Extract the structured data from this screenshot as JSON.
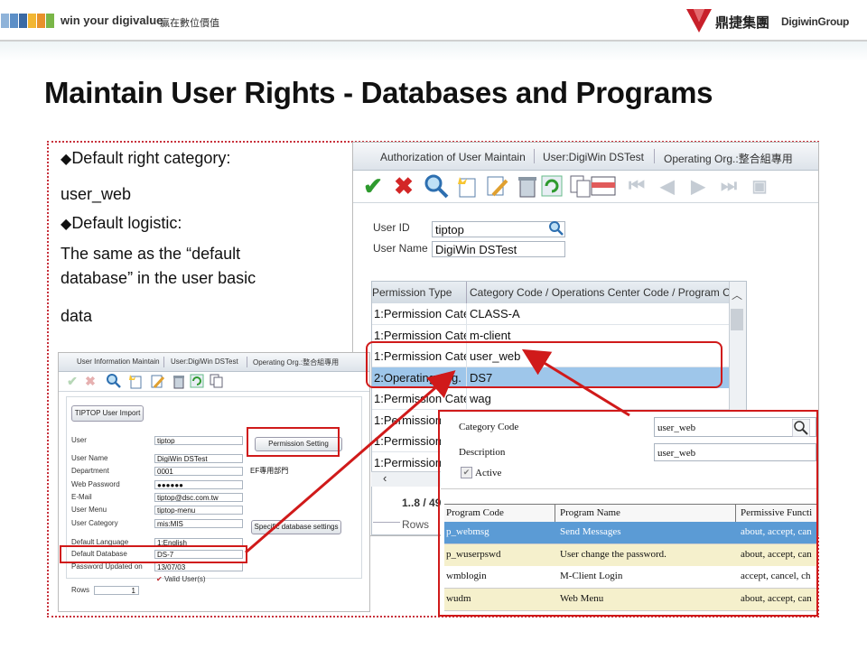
{
  "header": {
    "tagline": "win your digivalue",
    "tagline_cn": "贏在數位價值",
    "brand_cn": "鼎捷集團",
    "brand_en": "DigiwinGroup",
    "squares": [
      "#8fb3d9",
      "#5c8fc7",
      "#4a7db8",
      "#3b6aa4",
      "#f2b632",
      "#e8912b",
      "#7ab648"
    ]
  },
  "title": "Maintain User Rights - Databases and Programs",
  "notes": {
    "bullet1_title": "Default right category:",
    "bullet1_value": "user_web",
    "bullet2_title": "Default logistic:",
    "bullet2_line1": "The same as the “default",
    "bullet2_line2": "database” in the user basic",
    "bullet2_line3": "data"
  },
  "auth_window": {
    "tabs": [
      "Authorization of User Maintain",
      "User:DigiWin DSTest",
      "Operating Org.:整合組專用"
    ],
    "user_id_label": "User ID",
    "user_id_value": "tiptop",
    "user_name_label": "User Name",
    "user_name_value": "DigiWin DSTest",
    "grid_headers": [
      "Permission Type",
      "Category Code / Operations Center Code / Program Co"
    ],
    "rows": [
      {
        "type": "1:Permission Cate",
        "code": "CLASS-A"
      },
      {
        "type": "1:Permission Cate",
        "code": "m-client"
      },
      {
        "type": "1:Permission Cate",
        "code": "user_web"
      },
      {
        "type": "2:Operating Org.",
        "code": "DS7"
      },
      {
        "type": "1:Permission Cate",
        "code": "wag"
      },
      {
        "type": "1:Permission",
        "code": ""
      },
      {
        "type": "1:Permission",
        "code": ""
      },
      {
        "type": "1:Permission",
        "code": ""
      }
    ],
    "paging": "1..8 / 49",
    "rows_label": "Rows"
  },
  "user_info_window": {
    "tabs": [
      "User Information Maintain",
      "User:DigiWin DSTest",
      "Operating Org.:整合組專用"
    ],
    "import_button": "TIPTOP User Import",
    "permission_button": "Permission Setting",
    "db_settings_button": "Specific database settings",
    "fields": [
      {
        "label": "User",
        "value": "tiptop"
      },
      {
        "label": "User Name",
        "value": "DigiWin DSTest"
      },
      {
        "label": "Department",
        "value": "0001"
      },
      {
        "label": "Web Password",
        "value": "●●●●●●"
      },
      {
        "label": "E-Mail",
        "value": "tiptop@dsc.com.tw"
      },
      {
        "label": "User Menu",
        "value": "tiptop-menu"
      },
      {
        "label": "User Category",
        "value": "mis:MIS"
      },
      {
        "label": "Default Language",
        "value": "1:English"
      },
      {
        "label": "Default Database",
        "value": "DS-7"
      },
      {
        "label": "Password Updated on",
        "value": "13/07/03"
      }
    ],
    "department_name": "EF專用部門",
    "valid_user": "Valid User(s)",
    "rows_label": "Rows",
    "rows_value": "1"
  },
  "category_window": {
    "category_code_label": "Category Code",
    "category_code_value": "user_web",
    "description_label": "Description",
    "description_value": "user_web",
    "active_label": "Active",
    "table_headers": [
      "Program Code",
      "Program Name",
      "Permissive Functi"
    ],
    "rows": [
      {
        "code": "p_webmsg",
        "name": "Send Messages",
        "funcs": "about, accept, can"
      },
      {
        "code": "p_wuserpswd",
        "name": "User change the password.",
        "funcs": "about, accept, can"
      },
      {
        "code": "wmblogin",
        "name": "M-Client Login",
        "funcs": "accept, cancel, ch"
      },
      {
        "code": "wudm",
        "name": "Web Menu",
        "funcs": "about, accept, can"
      }
    ]
  },
  "colors": {
    "accent_red": "#d01a1a",
    "selected_row": "#9ec6ea",
    "highlight_row": "#5b9bd5",
    "alt_row": "#f5f0cc"
  }
}
